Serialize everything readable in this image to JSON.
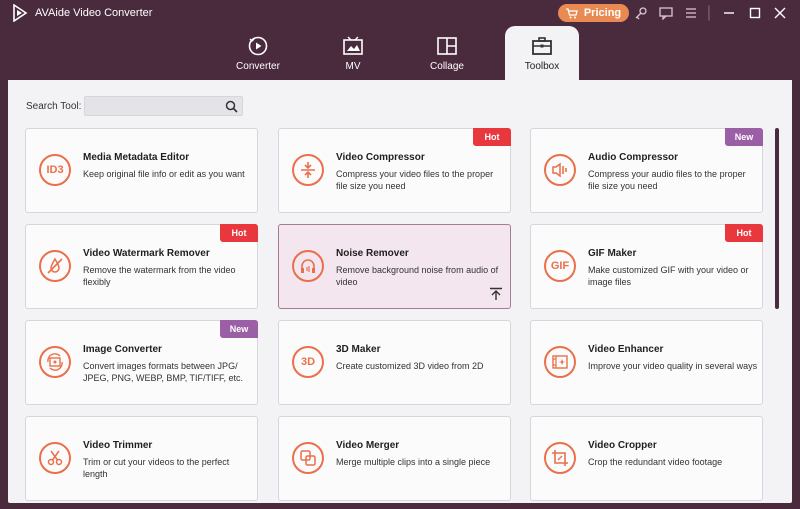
{
  "app": {
    "title": "AVAide Video Converter",
    "pricing_label": "Pricing"
  },
  "tabs": [
    {
      "label": "Converter",
      "icon": "converter-icon"
    },
    {
      "label": "MV",
      "icon": "mv-icon"
    },
    {
      "label": "Collage",
      "icon": "collage-icon"
    },
    {
      "label": "Toolbox",
      "icon": "toolbox-icon",
      "active": true
    }
  ],
  "search": {
    "label": "Search Tool:",
    "value": ""
  },
  "tools": [
    {
      "title": "Media Metadata Editor",
      "desc": "Keep original file info or edit as you want",
      "icon_text": "ID3",
      "badge": ""
    },
    {
      "title": "Video Compressor",
      "desc": "Compress your video files to the proper file size you need",
      "icon_text": "",
      "badge": "Hot"
    },
    {
      "title": "Audio Compressor",
      "desc": "Compress your audio files to the proper file size you need",
      "icon_text": "",
      "badge": "New"
    },
    {
      "title": "Video Watermark Remover",
      "desc": "Remove the watermark from the video flexibly",
      "icon_text": "",
      "badge": "Hot"
    },
    {
      "title": "Noise Remover",
      "desc": "Remove background noise from audio of video",
      "icon_text": "",
      "badge": ""
    },
    {
      "title": "GIF Maker",
      "desc": "Make customized GIF with your video or image files",
      "icon_text": "GIF",
      "badge": "Hot"
    },
    {
      "title": "Image Converter",
      "desc": "Convert images formats between JPG/ JPEG, PNG, WEBP, BMP, TIF/TIFF, etc.",
      "icon_text": "",
      "badge": "New"
    },
    {
      "title": "3D Maker",
      "desc": "Create customized 3D video from 2D",
      "icon_text": "3D",
      "badge": ""
    },
    {
      "title": "Video Enhancer",
      "desc": "Improve your video quality in several ways",
      "icon_text": "",
      "badge": ""
    },
    {
      "title": "Video Trimmer",
      "desc": "Trim or cut your videos to the perfect length",
      "icon_text": "",
      "badge": ""
    },
    {
      "title": "Video Merger",
      "desc": "Merge multiple clips into a single piece",
      "icon_text": "",
      "badge": ""
    },
    {
      "title": "Video Cropper",
      "desc": "Crop the redundant video footage",
      "icon_text": "",
      "badge": ""
    }
  ],
  "colors": {
    "accent": "#e9704a",
    "hot": "#e8383d",
    "new": "#9b5fa6",
    "frame": "#4a2a3d"
  }
}
